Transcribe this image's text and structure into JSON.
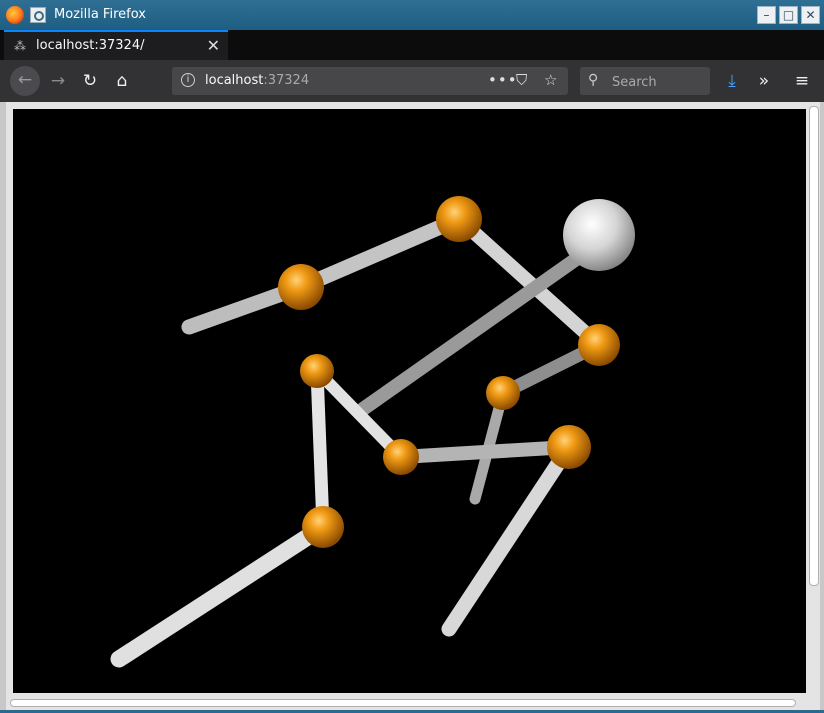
{
  "window": {
    "title": "Mozilla Firefox"
  },
  "tab": {
    "label": "localhost:37324/"
  },
  "urlbar": {
    "host": "localhost",
    "port": ":37324"
  },
  "search": {
    "placeholder": "Search"
  },
  "scene": {
    "background": "#000000",
    "atom_color": "#e88a00",
    "highlight_atom_color": "#d8d8d8",
    "bond_color": "#cfcfcf"
  }
}
